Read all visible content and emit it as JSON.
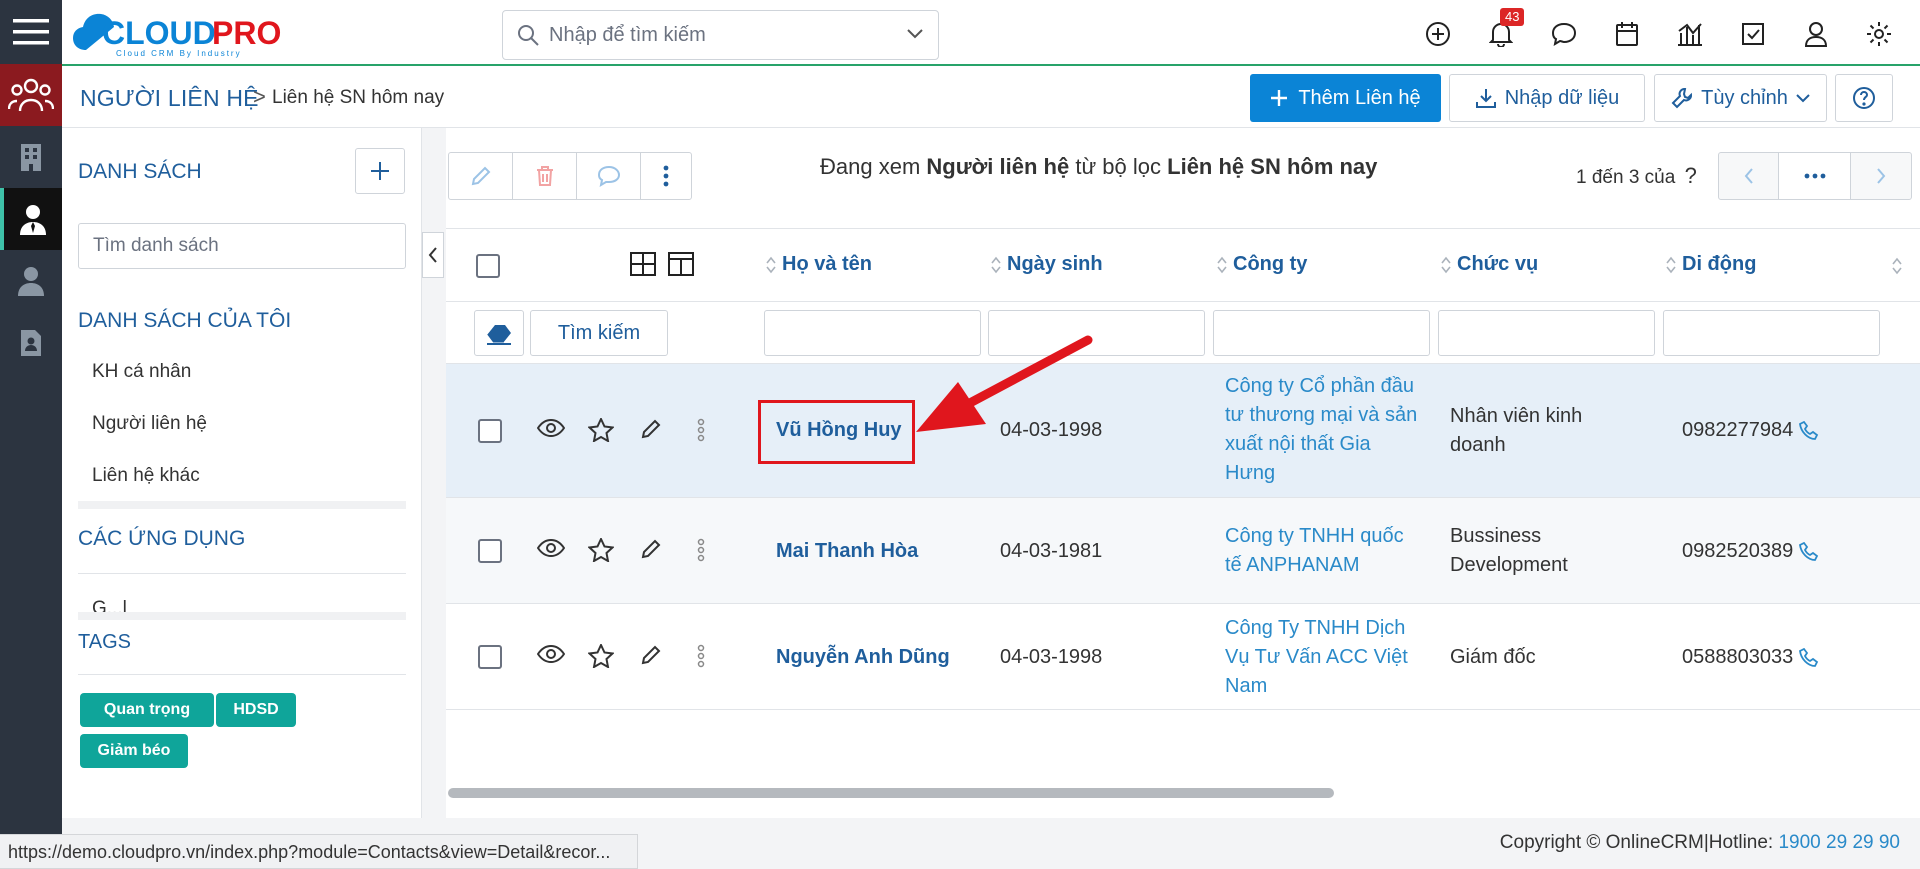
{
  "app": {
    "logo_text": "CLOUDPRO",
    "logo_sub": "Cloud CRM By Industry",
    "search_placeholder": "Nhập để tìm kiếm",
    "notification_count": "43"
  },
  "breadcrumb": {
    "root": "NGƯỜI LIÊN HỆ",
    "separator": ">",
    "leaf": "Liên hệ SN hôm nay"
  },
  "header_buttons": {
    "add": "Thêm Liên hệ",
    "import": "Nhập dữ liệu",
    "customize": "Tùy chỉnh"
  },
  "sidebar": {
    "title": "DANH SÁCH",
    "search_placeholder": "Tìm danh sách",
    "my_lists_title": "DANH SÁCH CỦA TÔI",
    "my_lists": [
      "KH cá nhân",
      "Người liên hệ",
      "Liên hệ khác"
    ],
    "apps_title": "CÁC ỨNG DỤNG",
    "apps_partial": "G...l",
    "tags_title": "TAGS",
    "tags": [
      "Quan trọng",
      "HDSD",
      "Giảm béo"
    ]
  },
  "toolbar": {
    "viewing_prefix": "Đang xem",
    "viewing_module": "Người liên hệ",
    "viewing_mid": "từ bộ lọc",
    "viewing_filter": "Liên hệ SN hôm nay",
    "pager_text": "1 đến 3 của",
    "pager_unknown": "?"
  },
  "table": {
    "columns": [
      "Họ và tên",
      "Ngày sinh",
      "Công ty",
      "Chức vụ",
      "Di động"
    ],
    "filter_search": "Tìm kiếm",
    "rows": [
      {
        "name": "Vũ Hồng Huy",
        "dob": "04-03-1998",
        "company": "Công ty Cổ phần đầu tư thương mại và sản xuất nội thất Gia Hưng",
        "title": "Nhân viên kinh doanh",
        "mobile": "0982277984"
      },
      {
        "name": "Mai Thanh Hòa",
        "dob": "04-03-1981",
        "company": "Công ty TNHH quốc tế ANPHANAM",
        "title": "Bussiness Development",
        "mobile": "0982520389"
      },
      {
        "name": "Nguyễn Anh Dũng",
        "dob": "04-03-1998",
        "company": "Công Ty TNHH Dịch Vụ Tư Vấn ACC Việt Nam",
        "title": "Giám đốc",
        "mobile": "0588803033"
      }
    ]
  },
  "footer": {
    "status_url": "https://demo.cloudpro.vn/index.php?module=Contacts&view=Detail&recor...",
    "copyright": "Copyright © OnlineCRM|Hotline:",
    "hotline": "1900 29 29 90"
  },
  "colors": {
    "accent": "#0b84d6",
    "link": "#1f5e9c",
    "tag": "#0fa59a",
    "highlight_row": "#e6eff8",
    "annotation": "#e0161d"
  }
}
